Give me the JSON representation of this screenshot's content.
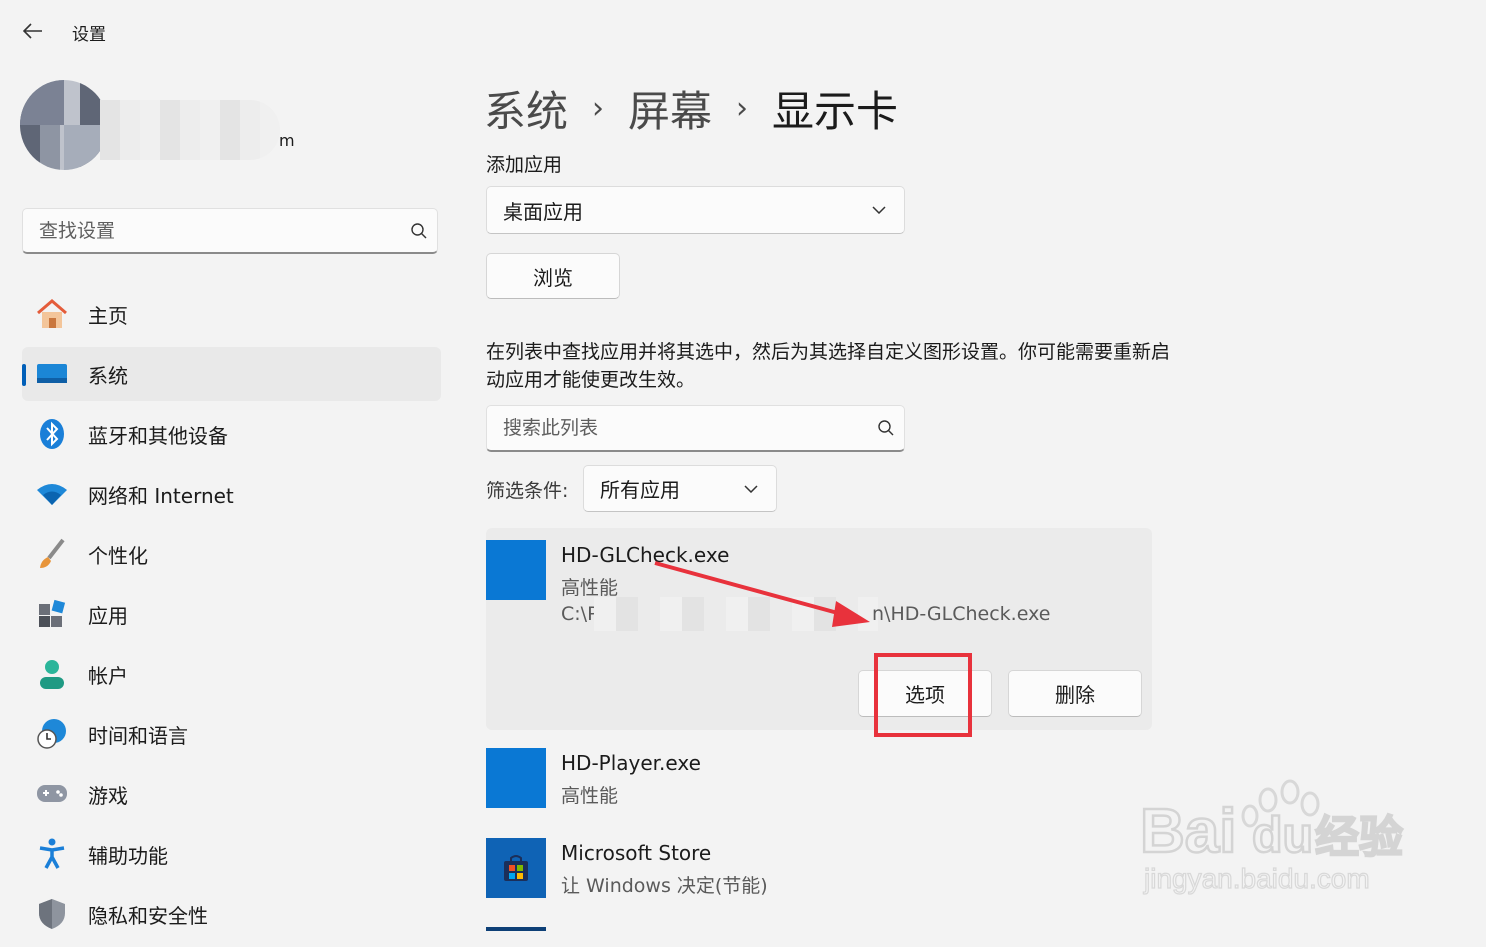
{
  "window": {
    "title": "设置"
  },
  "profile": {
    "name_suffix": "m"
  },
  "search": {
    "placeholder": "查找设置"
  },
  "nav": {
    "items": [
      {
        "label": "主页",
        "icon": "home-icon"
      },
      {
        "label": "系统",
        "icon": "system-display-icon",
        "active": true
      },
      {
        "label": "蓝牙和其他设备",
        "icon": "bluetooth-icon"
      },
      {
        "label": "网络和 Internet",
        "icon": "wifi-icon"
      },
      {
        "label": "个性化",
        "icon": "brush-icon"
      },
      {
        "label": "应用",
        "icon": "apps-icon"
      },
      {
        "label": "帐户",
        "icon": "account-icon"
      },
      {
        "label": "时间和语言",
        "icon": "time-language-icon"
      },
      {
        "label": "游戏",
        "icon": "gamepad-icon"
      },
      {
        "label": "辅助功能",
        "icon": "accessibility-icon"
      },
      {
        "label": "隐私和安全性",
        "icon": "shield-icon"
      }
    ]
  },
  "breadcrumb": {
    "items": [
      "系统",
      "屏幕",
      "显示卡"
    ],
    "separator": "›"
  },
  "add_app": {
    "label": "添加应用",
    "type_value": "桌面应用",
    "browse_label": "浏览"
  },
  "description": "在列表中查找应用并将其选中，然后为其选择自定义图形设置。你可能需要重新启动应用才能使更改生效。",
  "list_search": {
    "placeholder": "搜索此列表"
  },
  "filter": {
    "label": "筛选条件:",
    "value": "所有应用"
  },
  "apps": [
    {
      "name": "HD-GLCheck.exe",
      "preference": "高性能",
      "path_prefix": "C:\\P",
      "path_suffix": "n\\HD-GLCheck.exe",
      "options_label": "选项",
      "delete_label": "删除",
      "selected": true
    },
    {
      "name": "HD-Player.exe",
      "preference": "高性能"
    },
    {
      "name": "Microsoft Store",
      "preference": "让 Windows 决定(节能)"
    }
  ],
  "watermark": {
    "brand": "Bai du 经验",
    "url": "jingyan.baidu.com"
  },
  "colors": {
    "accent": "#005fb8",
    "app_icon": "#0a78d4",
    "annotation": "#e8323c"
  }
}
